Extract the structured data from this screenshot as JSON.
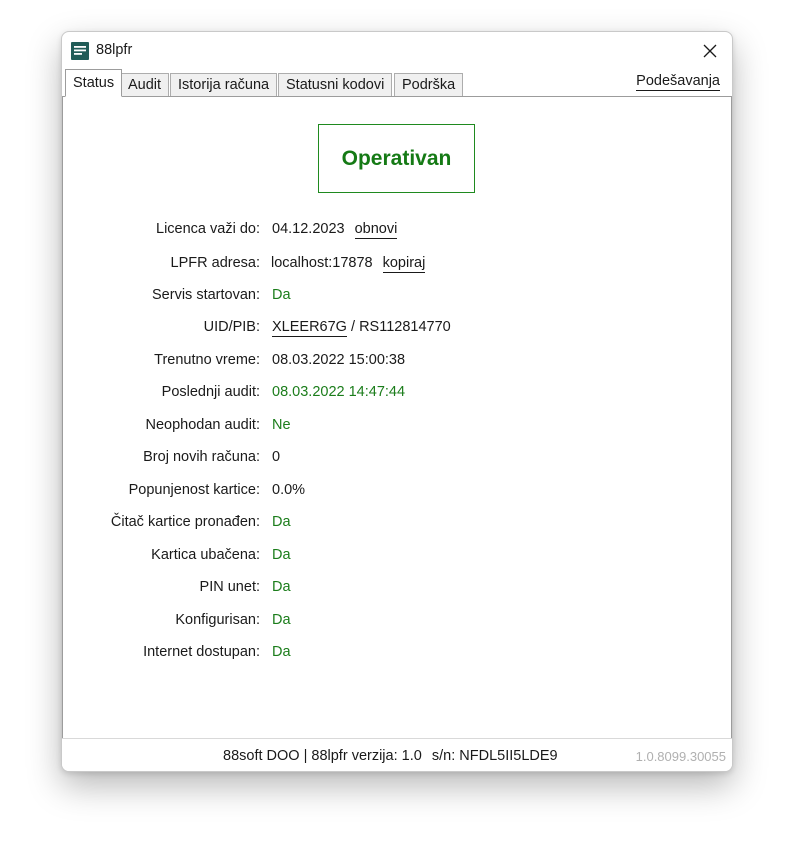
{
  "window": {
    "title": "88lpfr"
  },
  "tabs": [
    "Status",
    "Audit",
    "Istorija računa",
    "Statusni kodovi",
    "Podrška"
  ],
  "settings_label": "Podešavanja",
  "status": {
    "text": "Operativan",
    "color": "#157a15"
  },
  "rows": [
    {
      "label": "Licenca važi do:",
      "value": "04.12.2023",
      "link": "obnovi"
    },
    {
      "label": "LPFR adresa:",
      "value": "localhost:17878",
      "link": "kopiraj"
    },
    {
      "label": "Servis startovan:",
      "value": "Da"
    },
    {
      "label": "UID/PIB:",
      "uid": "XLEER67G",
      "sep": "/",
      "pib": "RS112814770"
    },
    {
      "label": "Trenutno vreme:",
      "value": "08.03.2022 15:00:38"
    },
    {
      "label": "Poslednji audit:",
      "value": "08.03.2022 14:47:44"
    },
    {
      "label": "Neophodan audit:",
      "value": "Ne"
    },
    {
      "label": "Broj novih računa:",
      "value": "0"
    },
    {
      "label": "Popunjenost kartice:",
      "value": "0.0%"
    },
    {
      "label": "Čitač kartice pronađen:",
      "value": "Da"
    },
    {
      "label": "Kartica ubačena:",
      "value": "Da"
    },
    {
      "label": "PIN unet:",
      "value": "Da"
    },
    {
      "label": "Konfigurisan:",
      "value": "Da"
    },
    {
      "label": "Internet dostupan:",
      "value": "Da"
    }
  ],
  "footer": {
    "company": "88soft DOO | 88lpfr",
    "version_label": "verzija:",
    "version": "1.0",
    "serial_label": "s/n:",
    "serial": "NFDL5II5LDE9",
    "build": "1.0.8099.30055"
  },
  "colors": {
    "success": "#1b7d1b",
    "build_text": "#b0b0b0"
  }
}
